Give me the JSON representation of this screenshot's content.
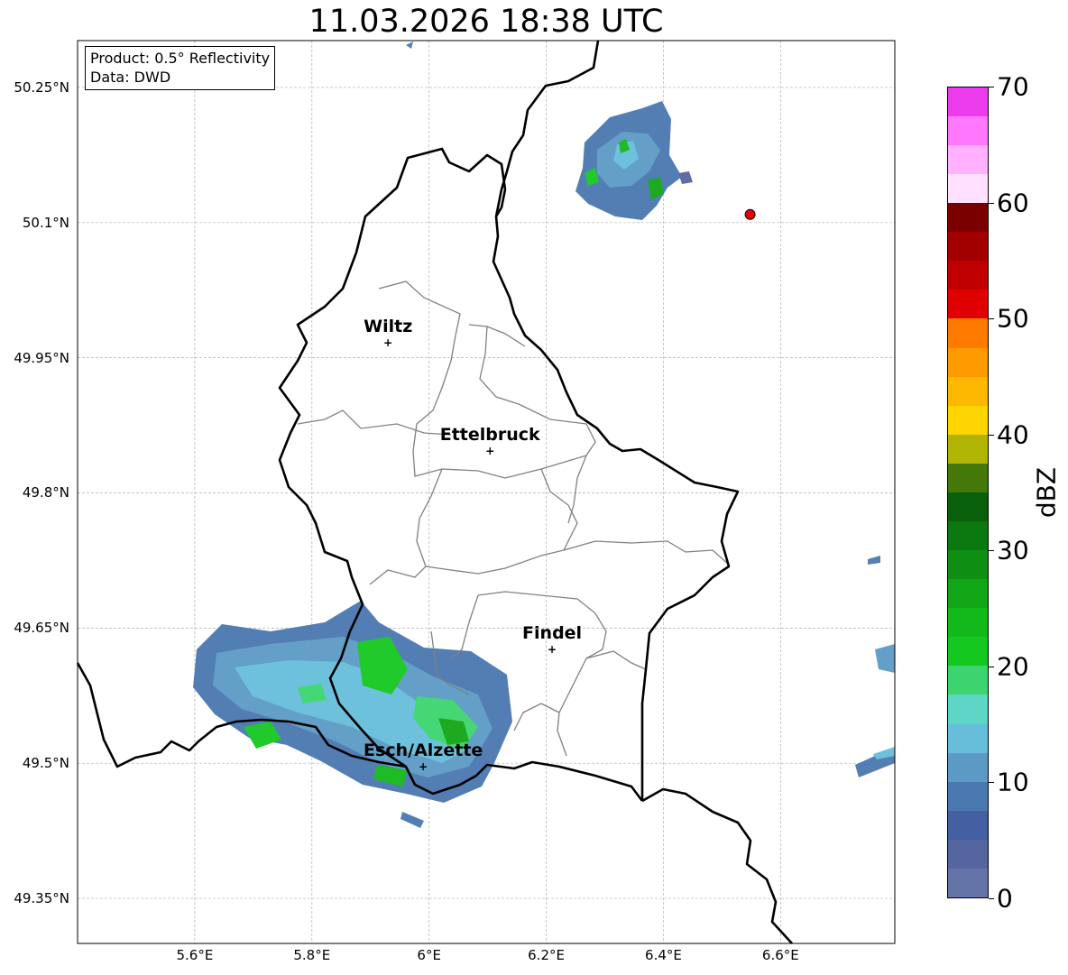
{
  "title": "11.03.2026 18:38 UTC",
  "info": {
    "product": "Product: 0.5° Reflectivity",
    "data": "Data: DWD"
  },
  "map": {
    "extent": {
      "lon_min": 5.4,
      "lon_max": 6.795,
      "lat_min": 49.3,
      "lat_max": 50.302
    },
    "lat_ticks": [
      {
        "value": 50.25,
        "label": "50.25°N"
      },
      {
        "value": 50.1,
        "label": "50.1°N"
      },
      {
        "value": 49.95,
        "label": "49.95°N"
      },
      {
        "value": 49.8,
        "label": "49.8°N"
      },
      {
        "value": 49.65,
        "label": "49.65°N"
      },
      {
        "value": 49.5,
        "label": "49.5°N"
      },
      {
        "value": 49.35,
        "label": "49.35°N"
      }
    ],
    "lon_ticks": [
      {
        "value": 5.6,
        "label": "5.6°E"
      },
      {
        "value": 5.8,
        "label": "5.8°E"
      },
      {
        "value": 6.0,
        "label": "6°E"
      },
      {
        "value": 6.2,
        "label": "6.2°E"
      },
      {
        "value": 6.4,
        "label": "6.4°E"
      },
      {
        "value": 6.6,
        "label": "6.6°E"
      }
    ],
    "grid": true,
    "cities": [
      {
        "name": "Wiltz",
        "lon": 5.93,
        "lat": 49.967
      },
      {
        "name": "Ettelbruck",
        "lon": 6.104,
        "lat": 49.847
      },
      {
        "name": "Findel",
        "lon": 6.21,
        "lat": 49.626
      },
      {
        "name": "Esch/Alzette",
        "lon": 5.99,
        "lat": 49.496
      }
    ],
    "radar_site": {
      "lon": 6.548,
      "lat": 50.109,
      "color": "#e8000b"
    }
  },
  "colorbar": {
    "label": "dBZ",
    "ticks": [
      "0",
      "10",
      "20",
      "30",
      "40",
      "50",
      "60",
      "70"
    ],
    "colors": [
      "#6474a8",
      "#5565a0",
      "#4460a2",
      "#4a78b0",
      "#5b9ac5",
      "#67bedb",
      "#5ed6c5",
      "#3cd46e",
      "#14c81f",
      "#13b81a",
      "#11a615",
      "#0e8e12",
      "#0c7810",
      "#08600b",
      "#44780b",
      "#b0b403",
      "#ffd500",
      "#ffb800",
      "#ff9b00",
      "#ff7b00",
      "#e10000",
      "#c00000",
      "#a20000",
      "#7a0000",
      "#ffe0ff",
      "#ffb0ff",
      "#ff78ff",
      "#ec3bec"
    ]
  }
}
